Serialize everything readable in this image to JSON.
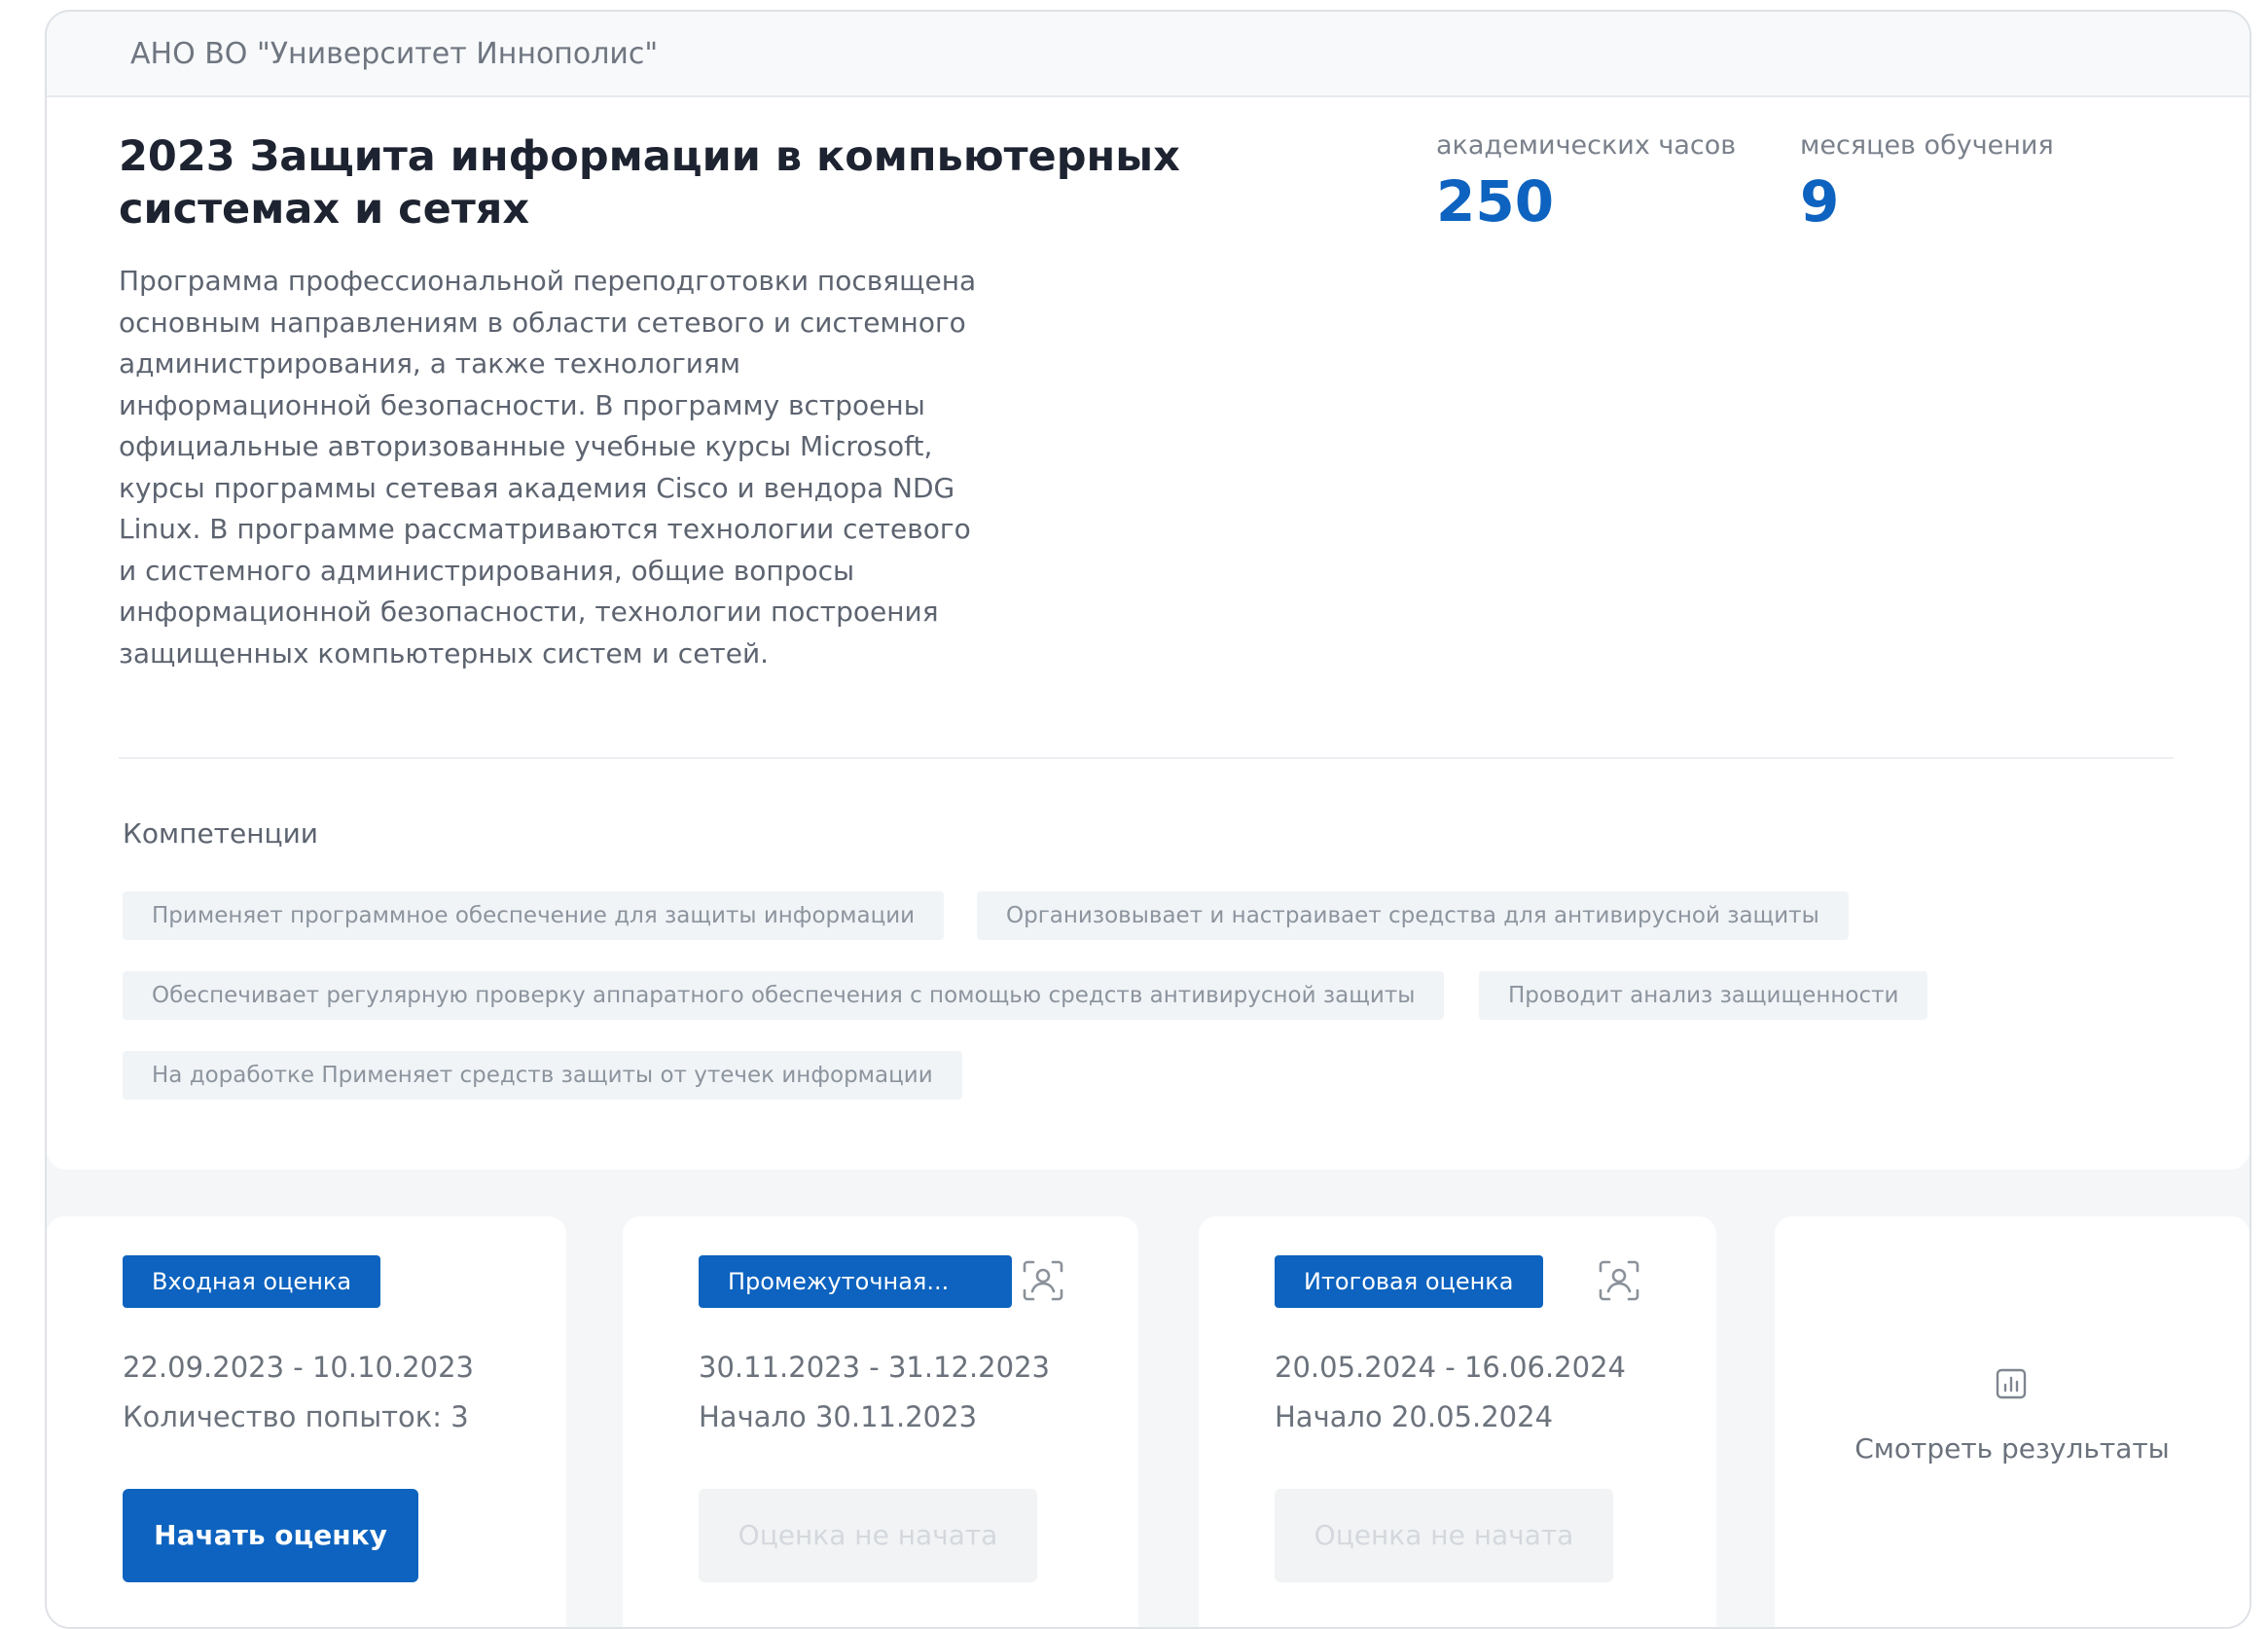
{
  "organization": "АНО ВО \"Университет Иннополис\"",
  "program": {
    "title": "2023 Защита информации в компьютерных системах и сетях",
    "description": "Программа профессиональной переподготовки посвящена основным направлениям в области сетевого и системного администрирования, а также технологиям информационной безопасности. В программу встроены официальные авторизованные учебные курсы Microsoft, курсы программы сетевая академия Cisco и вендора NDG Linux. В программе рассматриваются технологии сетевого и системного администрирования, общие вопросы информационной безопасности, технологии построения защищенных компьютерных систем и сетей.",
    "stats": {
      "hours_label": "академических часов",
      "hours_value": "250",
      "months_label": "месяцев обучения",
      "months_value": "9"
    }
  },
  "competencies": {
    "title": "Компетенции",
    "items": [
      "Применяет программное обеспечение для защиты информации",
      "Организовывает и настраивает средства для антивирусной защиты",
      "Обеспечивает регулярную проверку аппаратного обеспечения с помощью средств антивирусной защиты",
      "Проводит анализ защищенности",
      "На доработке Применяет средств защиты от утечек информации"
    ]
  },
  "assessments": [
    {
      "badge": "Входная оценка",
      "dates": "22.09.2023 - 10.10.2023",
      "info": "Количество попыток: 3",
      "button": "Начать оценку",
      "enabled": true
    },
    {
      "badge": "Промежуточная...",
      "dates": "30.11.2023 - 31.12.2023",
      "info": "Начало 30.11.2023",
      "button": "Оценка не начата",
      "enabled": false,
      "icon": "proctoring-user-icon"
    },
    {
      "badge": "Итоговая оценка",
      "dates": "20.05.2024 - 16.06.2024",
      "info": "Начало 20.05.2024",
      "button": "Оценка не начата",
      "enabled": false,
      "icon": "proctoring-user-icon"
    }
  ],
  "results": {
    "label": "Смотреть результаты",
    "icon": "bar-chart-icon"
  },
  "colors": {
    "accent": "#0d63bf",
    "background": "#f4f6f8",
    "tag_background": "#f1f4f7"
  }
}
